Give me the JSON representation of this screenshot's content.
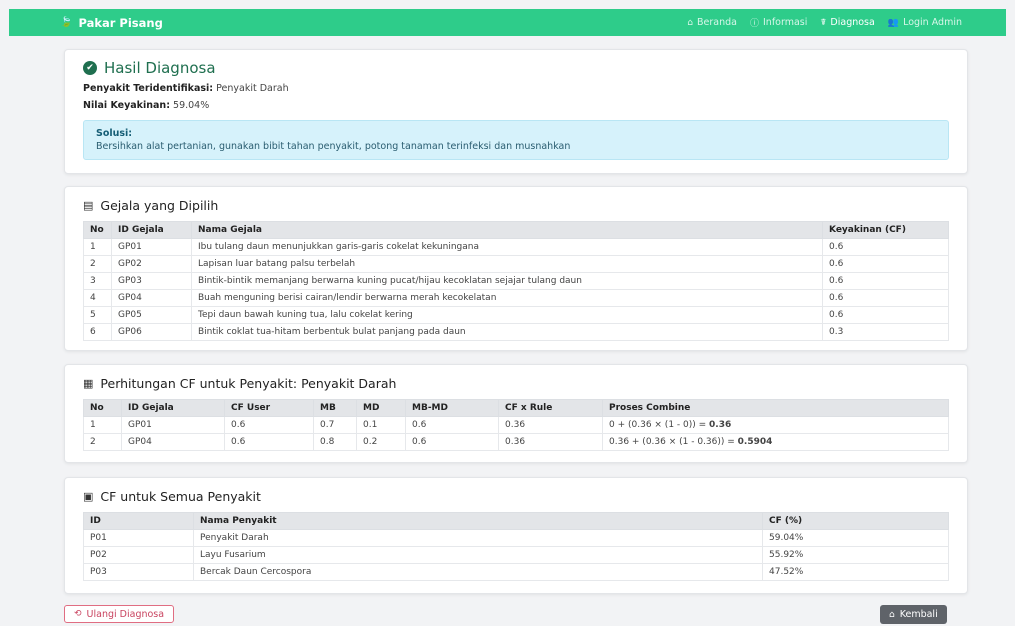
{
  "nav": {
    "brand": "Pakar Pisang",
    "brand_icon": "leaf-icon",
    "items": [
      {
        "label": "Beranda",
        "icon": "home-icon"
      },
      {
        "label": "Informasi",
        "icon": "info-icon"
      },
      {
        "label": "Diagnosa",
        "icon": "stethoscope-icon"
      },
      {
        "label": "Login Admin",
        "icon": "users-icon"
      }
    ]
  },
  "result": {
    "title": "Hasil Diagnosa",
    "disease_label": "Penyakit Teridentifikasi:",
    "disease_value": "Penyakit Darah",
    "confidence_label": "Nilai Keyakinan:",
    "confidence_value": "59.04%",
    "solution_label": "Solusi:",
    "solution_text": "Bersihkan alat pertanian, gunakan bibit tahan penyakit, potong tanaman terinfeksi dan musnahkan"
  },
  "symptoms": {
    "title": "Gejala yang Dipilih",
    "headers": [
      "No",
      "ID Gejala",
      "Nama Gejala",
      "Keyakinan (CF)"
    ],
    "rows": [
      [
        "1",
        "GP01",
        "Ibu tulang daun menunjukkan garis-garis cokelat kekuningana",
        "0.6"
      ],
      [
        "2",
        "GP02",
        "Lapisan luar batang palsu terbelah",
        "0.6"
      ],
      [
        "3",
        "GP03",
        "Bintik-bintik memanjang berwarna kuning pucat/hijau kecoklatan sejajar tulang daun",
        "0.6"
      ],
      [
        "4",
        "GP04",
        "Buah menguning berisi cairan/lendir berwarna merah kecokelatan",
        "0.6"
      ],
      [
        "5",
        "GP05",
        "Tepi daun bawah kuning tua, lalu cokelat kering",
        "0.6"
      ],
      [
        "6",
        "GP06",
        "Bintik coklat tua-hitam berbentuk bulat panjang pada daun",
        "0.3"
      ]
    ]
  },
  "calc": {
    "title": "Perhitungan CF untuk Penyakit: Penyakit Darah",
    "headers": [
      "No",
      "ID Gejala",
      "CF User",
      "MB",
      "MD",
      "MB-MD",
      "CF x Rule",
      "Proses Combine"
    ],
    "rows": [
      {
        "cells": [
          "1",
          "GP01",
          "0.6",
          "0.7",
          "0.1",
          "0.6",
          "0.36"
        ],
        "combine": "0 + (0.36 × (1 - 0)) = ",
        "result": "0.36"
      },
      {
        "cells": [
          "2",
          "GP04",
          "0.6",
          "0.8",
          "0.2",
          "0.6",
          "0.36"
        ],
        "combine": "0.36 + (0.36 × (1 - 0.36)) = ",
        "result": "0.5904"
      }
    ]
  },
  "all": {
    "title": "CF untuk Semua Penyakit",
    "headers": [
      "ID",
      "Nama Penyakit",
      "CF (%)"
    ],
    "rows": [
      [
        "P01",
        "Penyakit Darah",
        "59.04%"
      ],
      [
        "P02",
        "Layu Fusarium",
        "55.92%"
      ],
      [
        "P03",
        "Bercak Daun Cercospora",
        "47.52%"
      ]
    ]
  },
  "buttons": {
    "retry": "Ulangi Diagnosa",
    "back": "Kembali"
  }
}
